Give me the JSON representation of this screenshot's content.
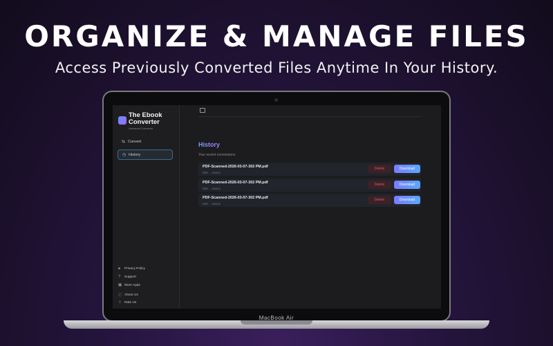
{
  "headline": "ORGANIZE & MANAGE FILES",
  "subline": "Access Previously Converted Files Anytime In Your History.",
  "device_label": "MacBook Air",
  "app": {
    "title": "The Ebook Converter",
    "subtitle": "Universal Converter"
  },
  "sidebar": {
    "items": [
      {
        "label": "Convert",
        "icon": "convert-arrows-icon",
        "active": false
      },
      {
        "label": "History",
        "icon": "clock-icon",
        "active": true
      }
    ],
    "footer": [
      {
        "label": "Privacy Policy",
        "icon": "lock-icon"
      },
      {
        "label": "Support",
        "icon": "question-icon"
      },
      {
        "label": "More Apps",
        "icon": "grid-icon"
      },
      {
        "label": "About Us",
        "icon": "info-icon"
      },
      {
        "label": "Rate Us",
        "icon": "star-icon"
      }
    ]
  },
  "main": {
    "title": "History",
    "subtitle": "Your recent conversions",
    "rows": [
      {
        "name": "PDF-Scanned-2026-03-07-302 PM.pdf",
        "meta": "PDF → DOCX",
        "delete_label": "Delete",
        "download_label": "Download"
      },
      {
        "name": "PDF-Scanned-2026-03-07-302 PM.pdf",
        "meta": "PDF → DOCX",
        "delete_label": "Delete",
        "download_label": "Download"
      },
      {
        "name": "PDF-Scanned-2026-03-07-302 PM.pdf",
        "meta": "PDF → DOCX",
        "delete_label": "Delete",
        "download_label": "Download"
      }
    ]
  },
  "colors": {
    "accent_gradient_start": "#7a7dff",
    "accent_gradient_end": "#5aa8ff",
    "delete_text": "#e05a62",
    "active_border": "#3b6d8a"
  }
}
